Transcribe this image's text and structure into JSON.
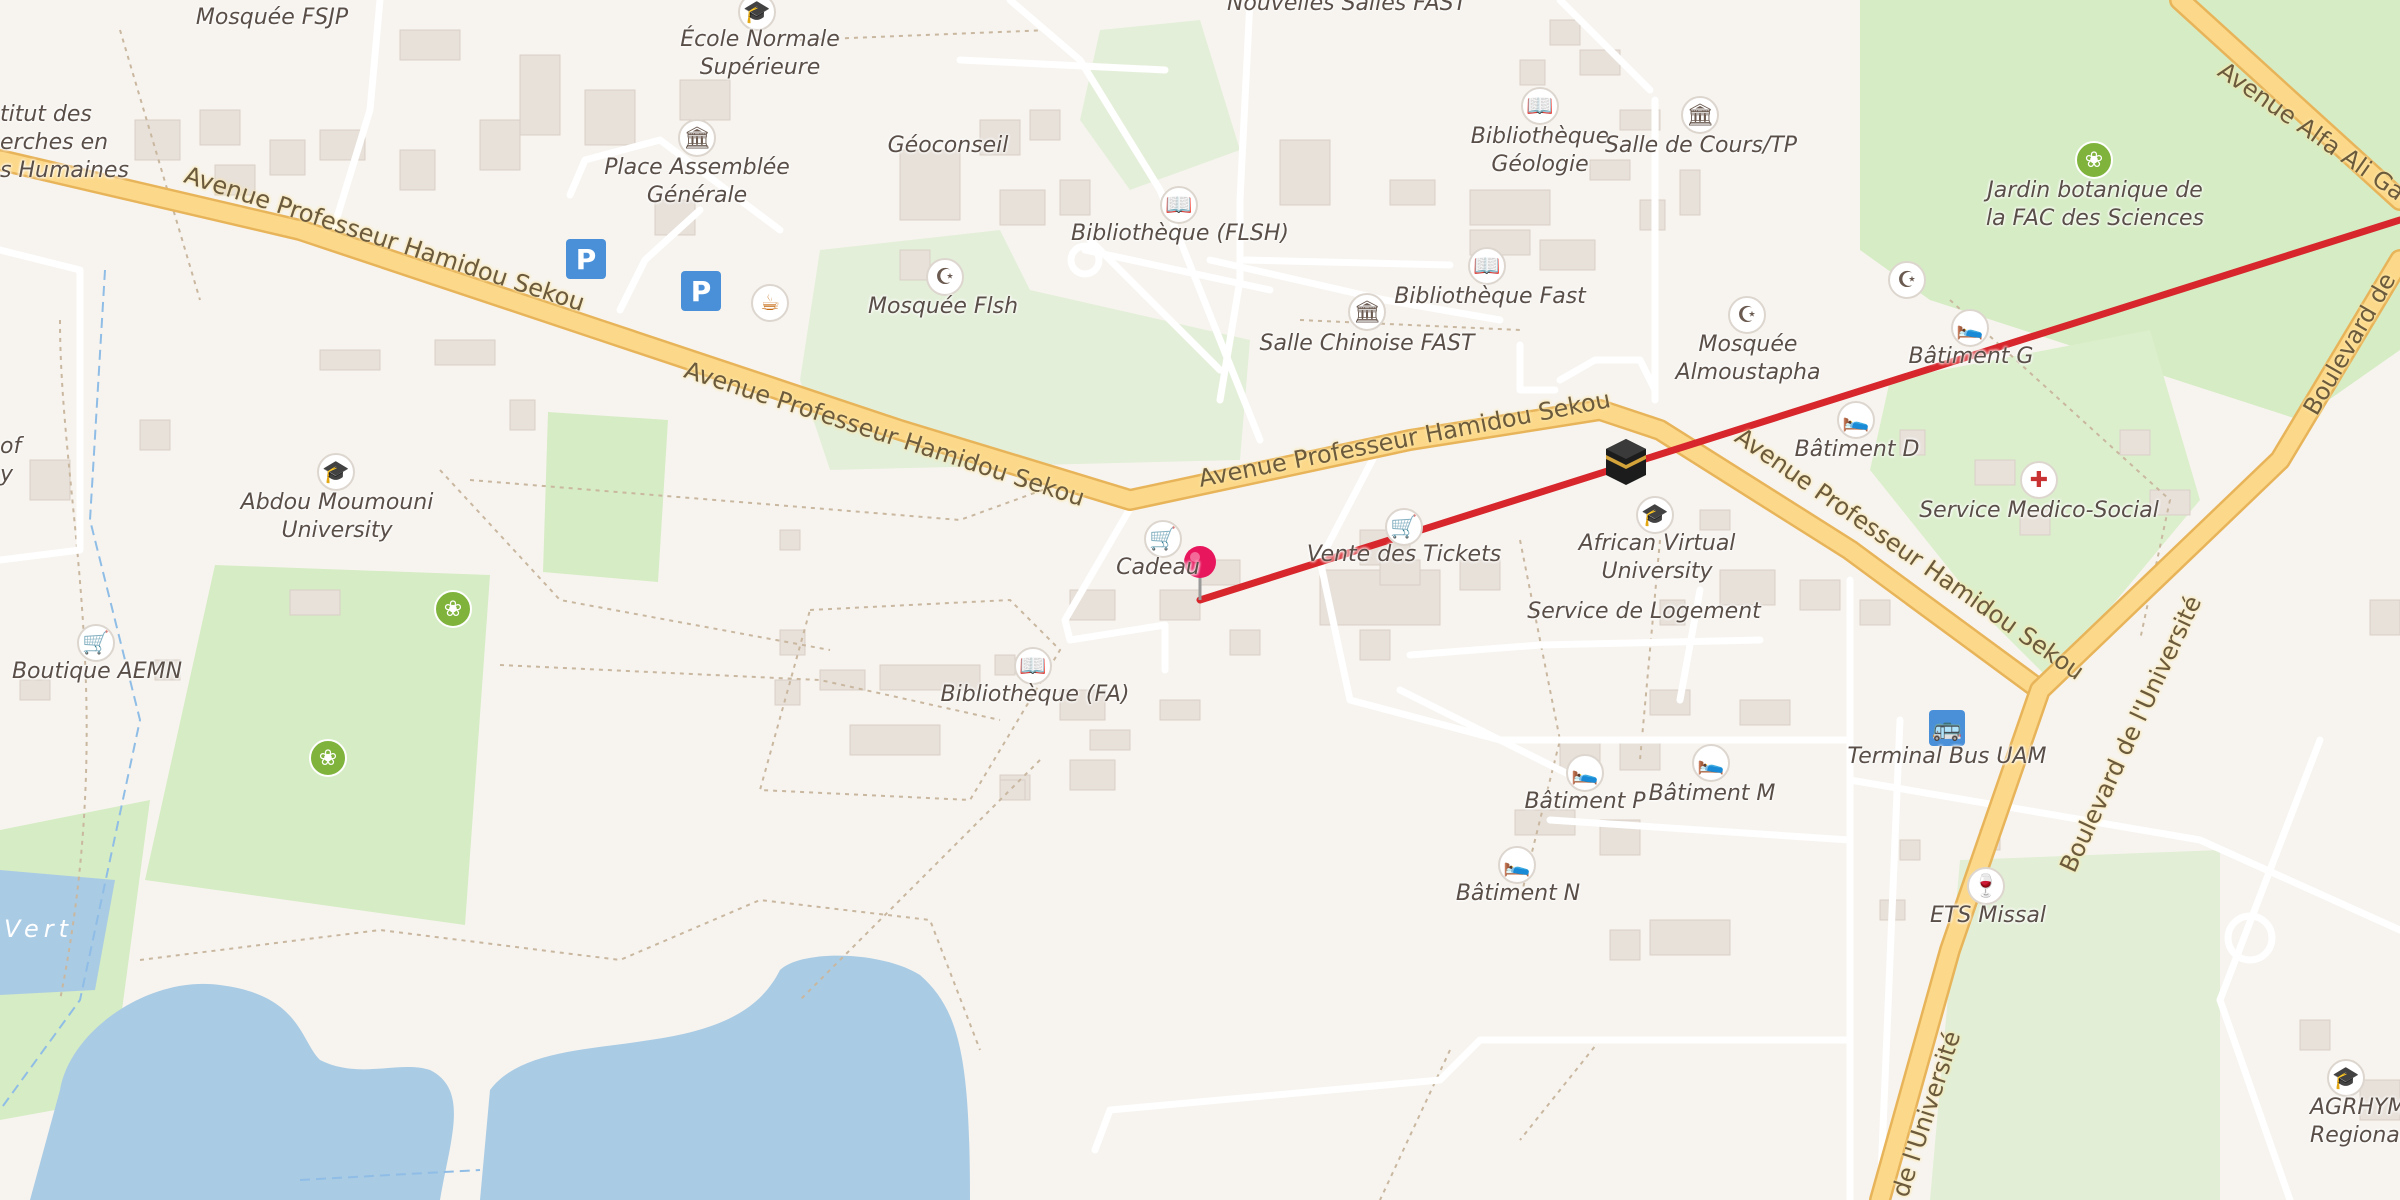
{
  "map": {
    "roads": {
      "main_w": "Avenue Professeur Hamidou Sekou",
      "main_mid": "Avenue Professeur Hamidou Sekou",
      "main_c": "Avenue Professeur Hamidou Sekou",
      "main_e": "Avenue Professeur Hamidou Sekou",
      "alfa": "Avenue Alfa Ali Gat",
      "univ_n": "Boulevard de l'Université",
      "univ_s": "de l'Université",
      "blvd_edge": "Boulevard de"
    },
    "places": {
      "mosquee_fsjp": "Mosquée FSJP",
      "ecole_normale": "École Normale\nSupérieure",
      "nouvelles_salles": "Nouvelles Salles FAST",
      "institut": "titut des\nerches en\ns Humaines",
      "place_assemblee": "Place Assemblée\nGénérale",
      "geoconseil": "Géoconseil",
      "bibliotheque_flsh": "Bibliothèque (FLSH)",
      "mosquee_flsh": "Mosquée Flsh",
      "bibliotheque_geologie": "Bibliothèque\nGéologie",
      "salle_cours": "Salle de Cours/TP",
      "bibliotheque_fast": "Bibliothèque Fast",
      "salle_chinoise": "Salle Chinoise FAST",
      "mosquee_almoustapha": "Mosquée\nAlmoustapha",
      "jardin": "Jardin botanique de\nla FAC des Sciences",
      "batiment_g": "Bâtiment G",
      "batiment_d": "Bâtiment D",
      "service_medico": "Service Medico-Social",
      "abdou_moumouni": "Abdou Moumouni\nUniversity",
      "boutique_aemn": "Boutique AEMN",
      "cadeau": "Cadeau",
      "vente_tickets": "Vente des Tickets",
      "african_virtual": "African Virtual\nUniversity",
      "service_logement": "Service de Logement",
      "bibliotheque_fa": "Bibliothèque (FA)",
      "batiment_p": "Bâtiment P",
      "batiment_m": "Bâtiment M",
      "batiment_n": "Bâtiment N",
      "terminal_bus": "Terminal Bus UAM",
      "ets_missal": "ETS Missal",
      "agrhymet": "AGRHYMET\nRegional Cen",
      "of_partial": "of\ny",
      "lac_vert": "Vert"
    },
    "parking_label": "P",
    "colors": {
      "background": "#f7f4ef",
      "main_road_fill": "#fcd98a",
      "main_road_casing": "#e8b45a",
      "water": "#aacbe4",
      "park": "#d6ecc4",
      "building": "#e8e1da",
      "route_line": "#d7262c",
      "pin": "#e8175d",
      "parking": "#4a90d9"
    },
    "icons": {
      "route_start": "map-pin-icon",
      "route_end": "kaaba-icon"
    }
  }
}
